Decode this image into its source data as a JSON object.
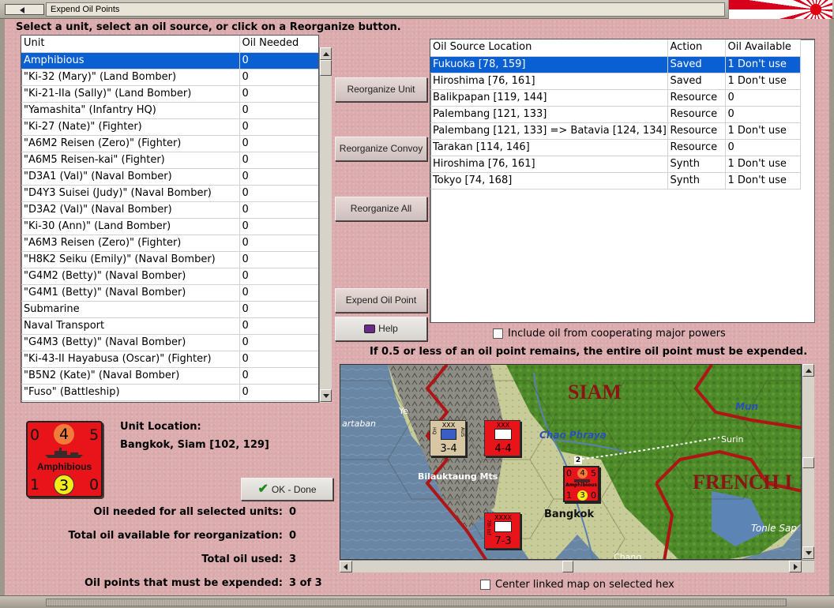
{
  "window": {
    "title": "Expend Oil Points"
  },
  "instruction": "Select a unit, select an oil source, or click on a Reorganize button.",
  "unit_table": {
    "headers": [
      "Unit",
      "Oil Needed"
    ],
    "rows": [
      [
        "Amphibious",
        "0"
      ],
      [
        "\"Ki-32 (Mary)\" (Land Bomber)",
        "0"
      ],
      [
        "\"Ki-21-IIa (Sally)\" (Land Bomber)",
        "0"
      ],
      [
        "\"Yamashita\" (Infantry HQ)",
        "0"
      ],
      [
        "\"Ki-27 (Nate)\" (Fighter)",
        "0"
      ],
      [
        "\"A6M2 Reisen (Zero)\" (Fighter)",
        "0"
      ],
      [
        "\"A6M5 Reisen-kai\" (Fighter)",
        "0"
      ],
      [
        "\"D3A1 (Val)\" (Naval Bomber)",
        "0"
      ],
      [
        "\"D4Y3 Suisei (Judy)\" (Naval Bomber)",
        "0"
      ],
      [
        "\"D3A2 (Val)\" (Naval Bomber)",
        "0"
      ],
      [
        "\"Ki-30 (Ann)\" (Land Bomber)",
        "0"
      ],
      [
        "\"A6M3 Reisen (Zero)\" (Fighter)",
        "0"
      ],
      [
        "\"H8K2 Seiku (Emily)\" (Naval Bomber)",
        "0"
      ],
      [
        "\"G4M2 (Betty)\" (Naval Bomber)",
        "0"
      ],
      [
        "\"G4M1 (Betty)\" (Naval Bomber)",
        "0"
      ],
      [
        "Submarine",
        "0"
      ],
      [
        "Naval Transport",
        "0"
      ],
      [
        "\"G4M3 (Betty)\" (Naval Bomber)",
        "0"
      ],
      [
        "\"Ki-43-II Hayabusa (Oscar)\" (Fighter)",
        "0"
      ],
      [
        "\"B5N2 (Kate)\" (Naval Bomber)",
        "0"
      ],
      [
        "\"Fuso\" (Battleship)",
        "0"
      ]
    ]
  },
  "oil_table": {
    "headers": [
      "Oil Source Location",
      "Action",
      "Oil Available"
    ],
    "rows": [
      [
        "Fukuoka [78, 159]",
        "Saved",
        "1 Don't use"
      ],
      [
        "Hiroshima [76, 161]",
        "Saved",
        "1 Don't use"
      ],
      [
        "Balikpapan [119, 144]",
        "Resource",
        "0"
      ],
      [
        "Palembang [121, 133]",
        "Resource",
        "0"
      ],
      [
        "Palembang [121, 133] => Batavia [124, 134]",
        "Resource",
        "1 Don't use"
      ],
      [
        "Tarakan [114, 146]",
        "Resource",
        "0"
      ],
      [
        "Hiroshima [76, 161]",
        "Synth",
        "1 Don't use"
      ],
      [
        "Tokyo [74, 168]",
        "Synth",
        "1 Don't use"
      ]
    ]
  },
  "buttons": {
    "reorganize_unit": "Reorganize Unit",
    "reorganize_convoy": "Reorganize Convoy",
    "reorganize_all": "Reorganize All",
    "expend_oil_point": "Expend Oil Point",
    "help": "Help",
    "ok_done": "OK - Done"
  },
  "counter": {
    "tl": "0",
    "tc": "4",
    "tr": "5",
    "bl": "1",
    "bc": "3",
    "br": "0",
    "label": "Amphibious"
  },
  "unit_location": {
    "label": "Unit Location:",
    "value": "Bangkok, Siam [102, 129]"
  },
  "stats": [
    {
      "label": "Oil needed for all selected units:",
      "value": "0"
    },
    {
      "label": "Total oil available for reorganization:",
      "value": "0"
    },
    {
      "label": "Total oil used:",
      "value": "3"
    },
    {
      "label": "Oil points that must be expended:",
      "value": "3 of 3"
    }
  ],
  "include_oil_label": "Include oil from cooperating major powers",
  "oil_note": "If 0.5 or less of an oil point remains, the entire oil point must be expended.",
  "center_map_label": "Center linked map on selected hex",
  "map": {
    "labels": {
      "siam": "SIAM",
      "french": "FRENCH I",
      "martaban": "artaban",
      "ye": "Ye",
      "chao_phraya": "Chao Phraya",
      "mun": "Mun",
      "surin": "Surin",
      "bilauktaung": "Bilauktaung Mts",
      "bangkok": "Bangkok",
      "tonle_sap": "Tonle Sap",
      "chang": "Chang"
    },
    "units": [
      {
        "size": "XXX",
        "value": "3-4",
        "side": "HQ",
        "nat": "AUS"
      },
      {
        "size": "XXX",
        "value": "4-4"
      },
      {
        "size": "XXXX",
        "value": "7-3",
        "side": "7th Inf"
      }
    ],
    "stack_count": "2",
    "selected_unit": {
      "tl": "0",
      "tc": "4",
      "tr": "5",
      "bl": "1",
      "bc": "3",
      "br": "0",
      "label": "Amphibious"
    }
  }
}
